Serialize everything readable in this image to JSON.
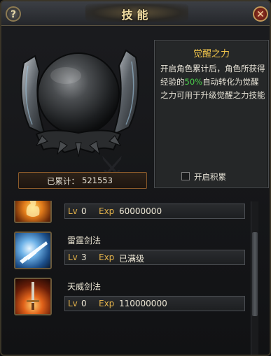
{
  "window": {
    "title": "技能"
  },
  "buttons": {
    "help": "?",
    "close": "✕"
  },
  "info": {
    "title": "觉醒之力",
    "desc_pre": "开启角色累计后，角色所获得经验的",
    "desc_highlight": "50%",
    "desc_post": "自动转化为觉醒之力可用于升级觉醒之力技能",
    "toggle_label": "开启积累",
    "toggle_checked": false
  },
  "accumulated": {
    "label": "已累计：",
    "value": "521553"
  },
  "labels": {
    "lv": "Lv",
    "exp": "Exp"
  },
  "skills": [
    {
      "name": "",
      "icon": "flame-spirit-icon",
      "level": "0",
      "exp": "60000000"
    },
    {
      "name": "雷霆剑法",
      "icon": "thunder-sword-icon",
      "level": "3",
      "exp": "已满级"
    },
    {
      "name": "天威剑法",
      "icon": "fire-sword-icon",
      "level": "0",
      "exp": "110000000"
    }
  ],
  "colors": {
    "accent_gold": "#f0c44a",
    "highlight_green": "#4cd24c",
    "label_orange": "#e3b24a"
  }
}
